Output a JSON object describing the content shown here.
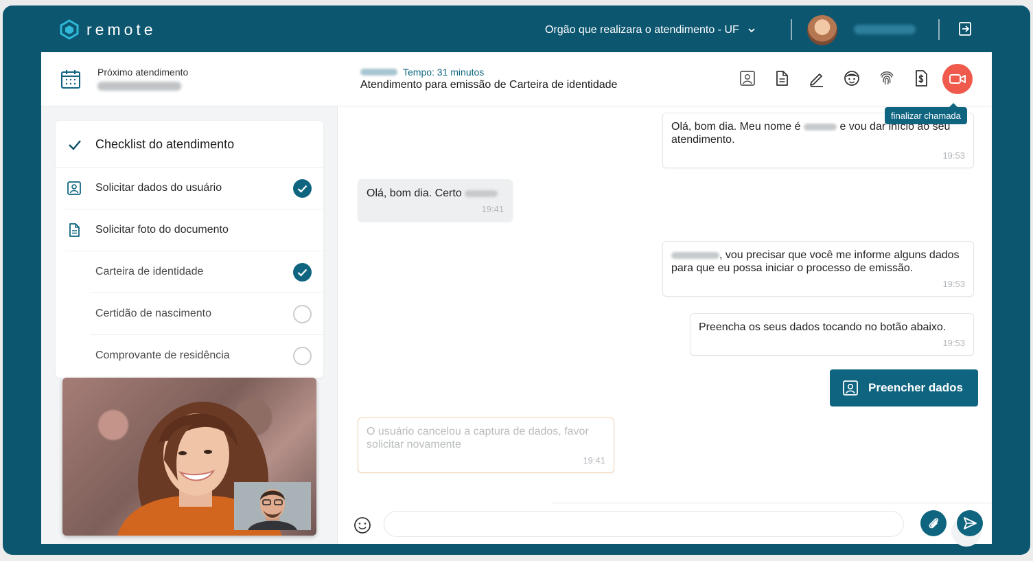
{
  "topbar": {
    "logo_text": "remote",
    "org_selector": "Orgão que realizara o atendimento - UF"
  },
  "next_appointment": {
    "label": "Próximo atendimento"
  },
  "checklist": {
    "title": "Checklist do atendimento",
    "items": [
      {
        "label": "Solicitar dados do usuário",
        "done": true
      },
      {
        "label": "Solicitar foto do documento"
      },
      {
        "label": "Carteira de identidade",
        "done": true
      },
      {
        "label": "Certidão de nascimento",
        "done": false
      },
      {
        "label": "Comprovante de residência",
        "done": false
      }
    ]
  },
  "chat_header": {
    "tempo": "Tempo: 31 minutos",
    "title": "Atendimento para emissão de Carteira de identidade",
    "tooltip": "finalizar chamada"
  },
  "messages": [
    {
      "pre": "Olá, bom dia. Meu nome é",
      "post": "e vou dar início ao seu atendimento.",
      "time": "19:53"
    },
    {
      "pre": "Olá, bom dia. Certo",
      "post": "",
      "time": "19:41"
    },
    {
      "pre": "",
      "post": ", vou precisar que você me informe alguns dados para que eu possa iniciar o processo de emissão.",
      "time": "19:53"
    },
    {
      "pre": "Preencha os seus dados tocando no botão abaixo.",
      "post": "",
      "time": "19:53"
    },
    {
      "pre": "O usuário cancelou a captura de dados, favor solicitar novamente",
      "post": "",
      "time": "19:41"
    }
  ],
  "fill_button": "Preencher dados",
  "compose": {
    "placeholder": ""
  },
  "colors": {
    "brand": "#0c5670",
    "accent": "#0f6580",
    "end_call": "#ef5a4c"
  }
}
